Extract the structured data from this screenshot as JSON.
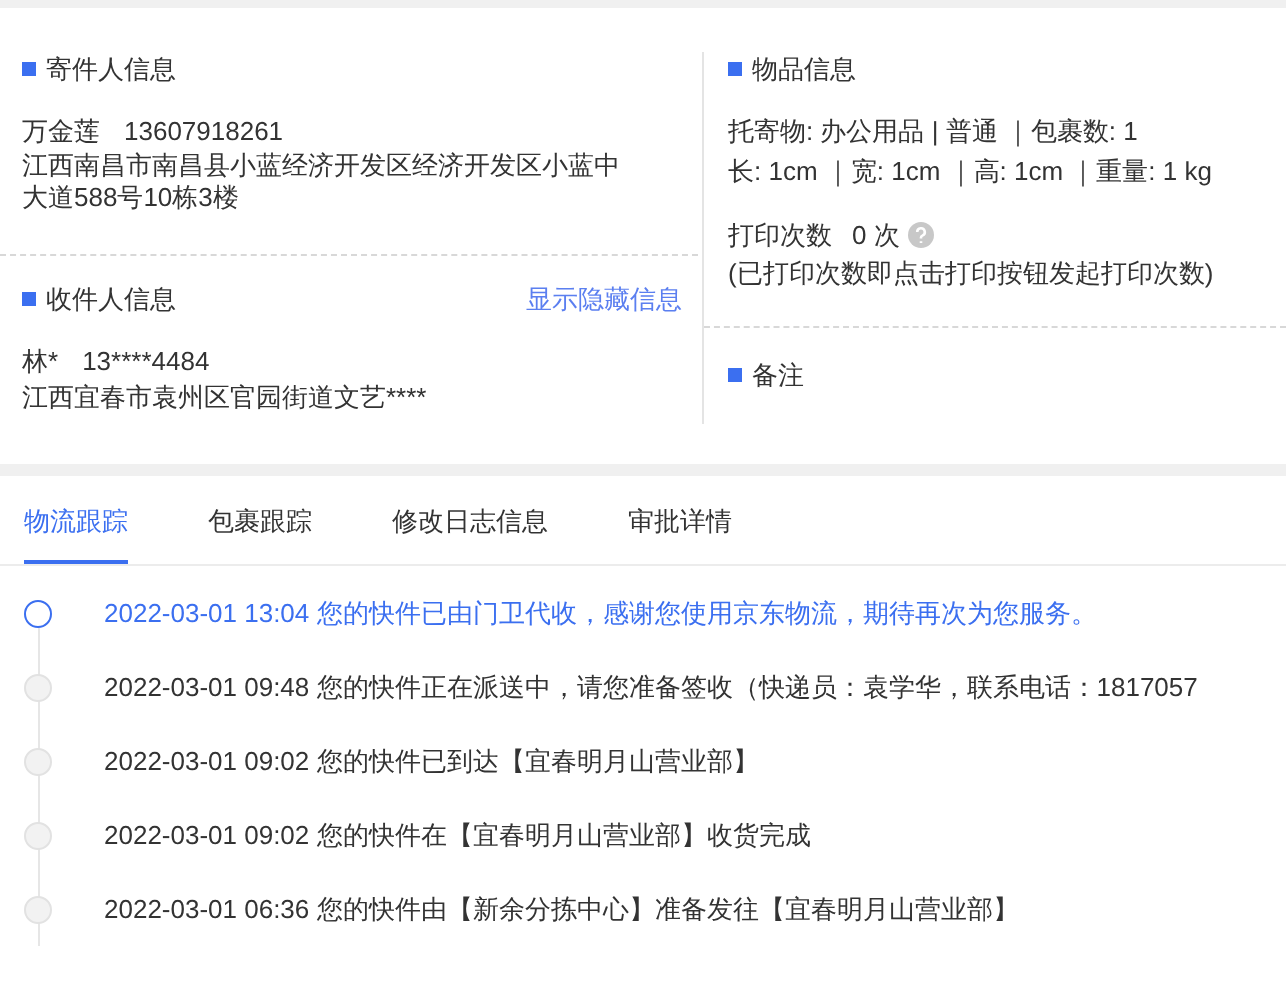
{
  "sender": {
    "title": "寄件人信息",
    "name": "万金莲",
    "phone": "13607918261",
    "address": "江西南昌市南昌县小蓝经济开发区经济开发区小蓝中大道588号10栋3楼"
  },
  "receiver": {
    "title": "收件人信息",
    "link": "显示隐藏信息",
    "name": "林*",
    "phone": "13****4484",
    "address": "江西宜春市袁州区官园街道文艺****"
  },
  "goods": {
    "title": "物品信息",
    "line_1": "托寄物: 办公用品 | 普通 ｜包裹数: 1",
    "line_2": "长: 1cm ｜宽: 1cm ｜高: 1cm ｜重量: 1 kg",
    "print_label": "打印次数",
    "print_count": "0 次",
    "print_note": "(已打印次数即点击打印按钮发起打印次数)"
  },
  "remarks": {
    "title": "备注"
  },
  "tabs": [
    {
      "label": "物流跟踪",
      "selected": true
    },
    {
      "label": "包裹跟踪",
      "selected": false
    },
    {
      "label": "修改日志信息",
      "selected": false
    },
    {
      "label": "审批详情",
      "selected": false
    }
  ],
  "timeline": [
    {
      "text": "2022-03-01 13:04 您的快件已由门卫代收，感谢您使用京东物流，期待再次为您服务。",
      "active": true
    },
    {
      "text": "2022-03-01 09:48 您的快件正在派送中，请您准备签收（快递员：袁学华，联系电话：1817057",
      "active": false
    },
    {
      "text": "2022-03-01 09:02 您的快件已到达【宜春明月山营业部】",
      "active": false
    },
    {
      "text": "2022-03-01 09:02 您的快件在【宜春明月山营业部】收货完成",
      "active": false
    },
    {
      "text": "2022-03-01 06:36 您的快件由【新余分拣中心】准备发往【宜春明月山营业部】",
      "active": false
    }
  ]
}
